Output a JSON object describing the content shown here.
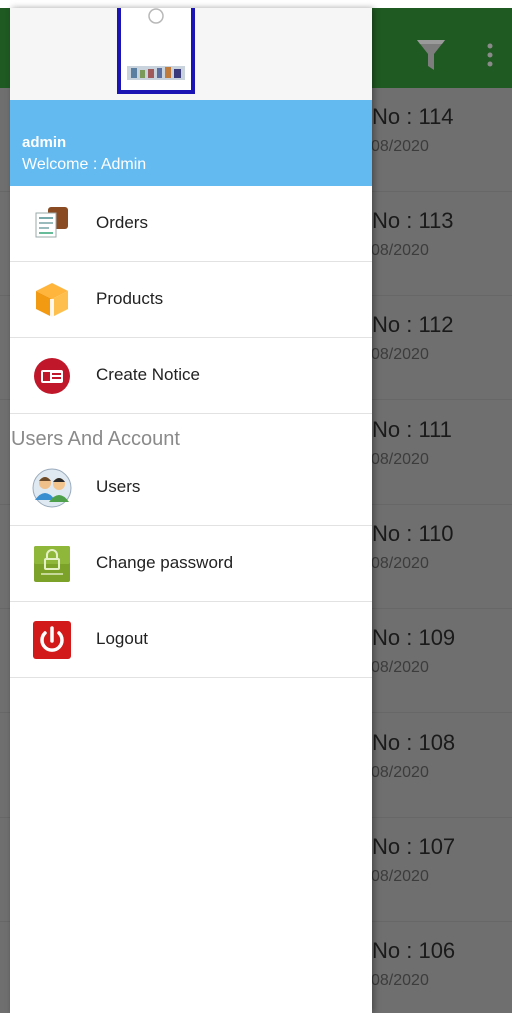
{
  "toolbar": {
    "filter_icon": "filter-funnel-icon",
    "more_icon": "more-vert-icon",
    "color": "#1f5a22"
  },
  "orders_list": [
    {
      "number": "No : 114",
      "date": "08/2020"
    },
    {
      "number": "No : 113",
      "date": "08/2020"
    },
    {
      "number": "No : 112",
      "date": "08/2020"
    },
    {
      "number": "No : 111",
      "date": "08/2020"
    },
    {
      "number": "No : 110",
      "date": "08/2020"
    },
    {
      "number": "No : 109",
      "date": "08/2020"
    },
    {
      "number": "No : 108",
      "date": "08/2020"
    },
    {
      "number": "No : 107",
      "date": "08/2020"
    },
    {
      "number": "No : 106",
      "date": "08/2020"
    }
  ],
  "drawer": {
    "header_color": "#63baf1",
    "user": {
      "name": "admin",
      "welcome": "Welcome : Admin"
    },
    "menu": [
      {
        "label": "Orders",
        "icon": "orders-icon"
      },
      {
        "label": "Products",
        "icon": "products-box-icon"
      },
      {
        "label": "Create Notice",
        "icon": "notice-card-icon"
      }
    ],
    "section_title": "Users And Account",
    "account_menu": [
      {
        "label": "Users",
        "icon": "users-icon"
      },
      {
        "label": "Change password",
        "icon": "lock-icon"
      },
      {
        "label": "Logout",
        "icon": "power-icon"
      }
    ]
  }
}
